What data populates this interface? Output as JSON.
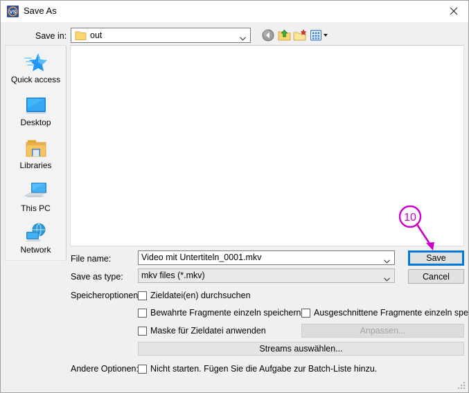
{
  "window": {
    "title": "Save As",
    "app_icon": "vs-shield-icon",
    "close_label": "close-icon"
  },
  "toolbar": {
    "save_in_label": "Save in:",
    "current_folder": "out",
    "folder_icon": "folder-icon",
    "dropdown_icon": "chevron-down-icon",
    "buttons": [
      {
        "name": "back-button",
        "icon": "back-arrow-icon",
        "tooltip": "Back"
      },
      {
        "name": "up-one-level-button",
        "icon": "up-folder-icon",
        "tooltip": "Up One Level"
      },
      {
        "name": "new-folder-button",
        "icon": "new-folder-icon",
        "tooltip": "Create New Folder"
      },
      {
        "name": "views-button",
        "icon": "views-grid-icon",
        "tooltip": "Views"
      }
    ]
  },
  "places": [
    {
      "label": "Quick access",
      "icon": "quick-access-star-icon"
    },
    {
      "label": "Desktop",
      "icon": "desktop-monitor-icon"
    },
    {
      "label": "Libraries",
      "icon": "libraries-folder-icon"
    },
    {
      "label": "This PC",
      "icon": "this-pc-icon"
    },
    {
      "label": "Network",
      "icon": "network-globe-icon"
    }
  ],
  "file_list": {
    "items": [],
    "empty": true
  },
  "form": {
    "file_name_label": "File name:",
    "file_name_value": "Video mit Untertiteln_0001.mkv",
    "save_as_type_label": "Save as type:",
    "save_as_type_value": "mkv files (*.mkv)",
    "speicheroptionen_label": "Speicheroptionen:",
    "andere_optionen_label": "Andere Optionen:"
  },
  "checkboxes": [
    {
      "label": "Zieldatei(en) durchsuchen",
      "checked": false
    },
    {
      "label": "Bewahrte Fragmente einzeln speichern",
      "checked": false
    },
    {
      "label": "Maske für Zieldatei anwenden",
      "checked": false
    },
    {
      "label": "Ausgeschnittene Fragmente einzeln speichern",
      "checked": false
    },
    {
      "label": "Nicht starten. Fügen Sie die Aufgabe zur Batch-Liste hinzu.",
      "checked": false
    }
  ],
  "buttons": {
    "save": "Save",
    "cancel": "Cancel",
    "anpassen": "Anpassen...",
    "anpassen_enabled": false,
    "streams": "Streams auswählen..."
  },
  "annotation": {
    "number": "10",
    "color": "#cc00cc",
    "points_to": "save-button"
  },
  "colors": {
    "accent": "#0078d7",
    "dialog_bg": "#f0f0f0",
    "places_bg": "#f3f3f3",
    "annotation": "#cc00cc"
  }
}
